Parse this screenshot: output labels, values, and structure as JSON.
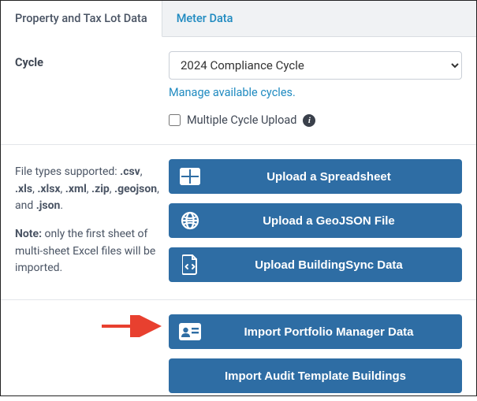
{
  "tabs": {
    "property": "Property and Tax Lot Data",
    "meter": "Meter Data"
  },
  "cycle": {
    "label": "Cycle",
    "selected": "2024 Compliance Cycle",
    "manage_link": "Manage available cycles.",
    "multi_label": "Multiple Cycle Upload"
  },
  "filetext": {
    "line1a": "File types supported: ",
    "ext1": ".csv",
    "sep1": ", ",
    "ext2": ".xls",
    "sep2": ", ",
    "ext3": ".xlsx",
    "sep3": ", ",
    "ext4": ".xml",
    "sep4": ", ",
    "ext5": ".zip",
    "sep5": ", ",
    "ext6": ".geojson",
    "sep6": ", and ",
    "ext7": ".json",
    "end1": ".",
    "note_label": "Note:",
    "note_text": " only the first sheet of multi-sheet Excel files will be imported."
  },
  "buttons": {
    "spreadsheet": "Upload a Spreadsheet",
    "geojson": "Upload a GeoJSON File",
    "bsync": "Upload BuildingSync Data",
    "pm": "Import Portfolio Manager Data",
    "audit": "Import Audit Template Buildings"
  }
}
